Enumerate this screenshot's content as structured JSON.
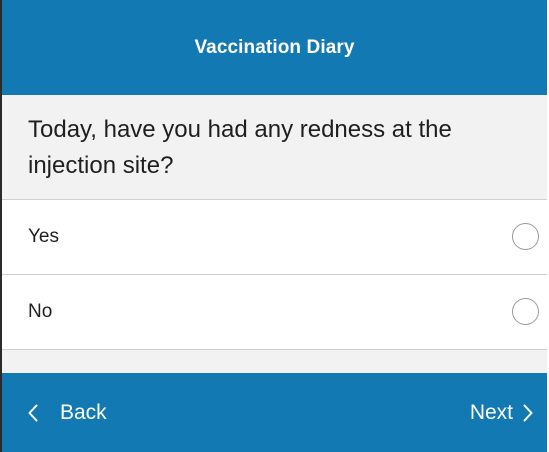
{
  "header": {
    "title": "Vaccination Diary"
  },
  "question": {
    "text": "Today, have you had any redness at the injection site?"
  },
  "options": [
    {
      "label": "Yes",
      "selected": false
    },
    {
      "label": "No",
      "selected": false
    }
  ],
  "footer": {
    "back_label": "Back",
    "next_label": "Next"
  },
  "icons": {
    "back": "chevron-left-icon",
    "next": "chevron-right-icon",
    "radio": "radio-unchecked-icon"
  },
  "colors": {
    "primary": "#1279b3",
    "background": "#f2f2f2",
    "option_background": "#ffffff",
    "divider": "#d0d0d0",
    "radio_border": "#9a9a9a",
    "text": "#1f1f1f"
  }
}
